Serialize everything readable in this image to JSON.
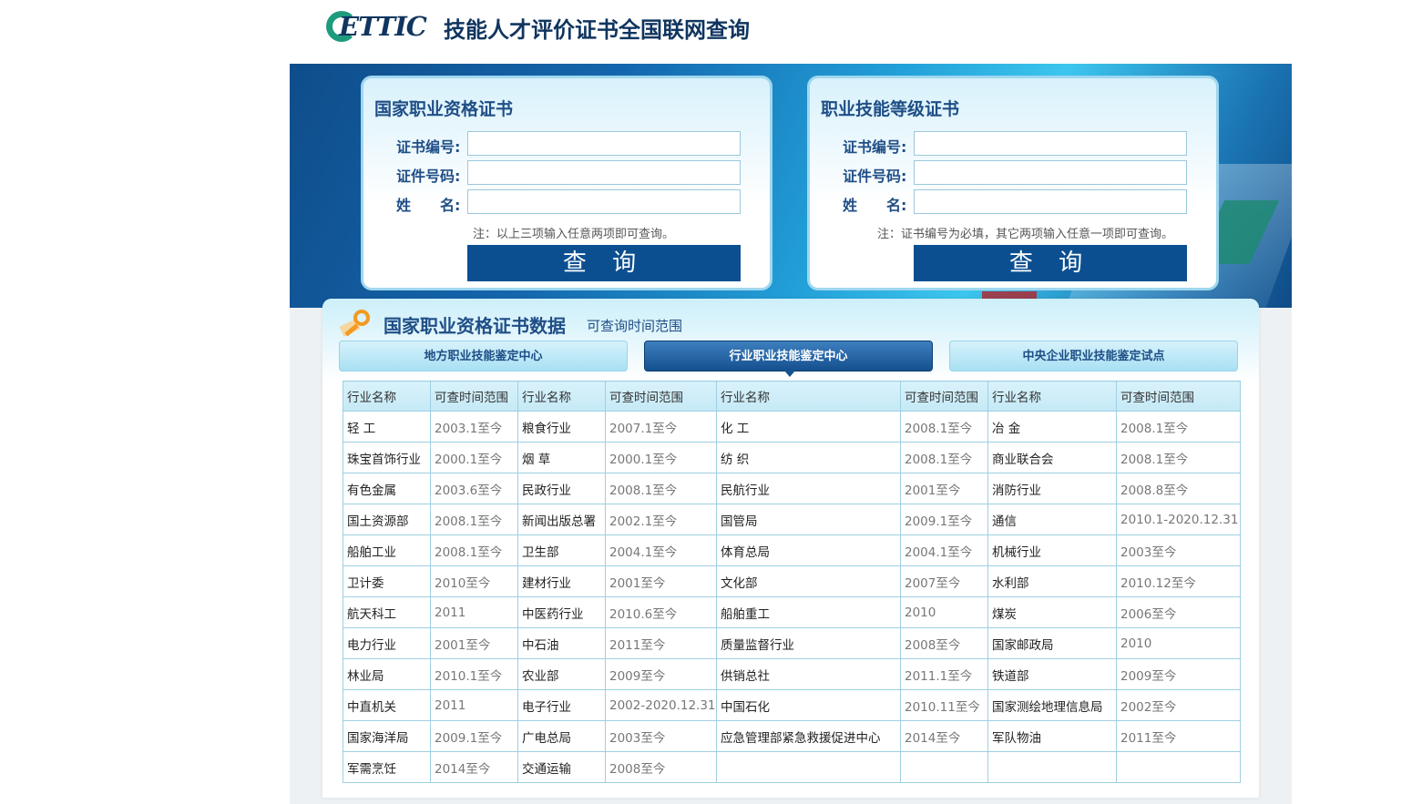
{
  "header": {
    "logo_text": "ETTIC",
    "title": "技能人才评价证书全国联网查询"
  },
  "query_left": {
    "title": "国家职业资格证书",
    "labels": [
      "证书编号:",
      "证件号码:",
      "姓　　名:"
    ],
    "note": "注：以上三项输入任意两项即可查询。",
    "button": "查 询"
  },
  "query_right": {
    "title": "职业技能等级证书",
    "labels": [
      "证书编号:",
      "证件号码:",
      "姓　　名:"
    ],
    "note": "注：证书编号为必填，其它两项输入任意一项即可查询。",
    "button": "查 询"
  },
  "section": {
    "title": "国家职业资格证书数据",
    "subtitle": "可查询时间范围",
    "tabs": [
      {
        "label": "地方职业技能鉴定中心",
        "active": false
      },
      {
        "label": "行业职业技能鉴定中心",
        "active": true
      },
      {
        "label": "中央企业职业技能鉴定试点",
        "active": false
      }
    ]
  },
  "table": {
    "headers": [
      "行业名称",
      "可查时间范围",
      "行业名称",
      "可查时间范围",
      "行业名称",
      "可查时间范围",
      "行业名称",
      "可查时间范围"
    ],
    "rows": [
      [
        "轻 工",
        "2003.1至今",
        "粮食行业",
        "2007.1至今",
        "化 工",
        "2008.1至今",
        "冶 金",
        "2008.1至今"
      ],
      [
        "珠宝首饰行业",
        "2000.1至今",
        "烟 草",
        "2000.1至今",
        "纺 织",
        "2008.1至今",
        "商业联合会",
        "2008.1至今"
      ],
      [
        "有色金属",
        "2003.6至今",
        "民政行业",
        "2008.1至今",
        "民航行业",
        "2001至今",
        "消防行业",
        "2008.8至今"
      ],
      [
        "国土资源部",
        "2008.1至今",
        "新闻出版总署",
        "2002.1至今",
        "国管局",
        "2009.1至今",
        "通信",
        "2010.1-2020.12.31"
      ],
      [
        "船舶工业",
        "2008.1至今",
        "卫生部",
        "2004.1至今",
        "体育总局",
        "2004.1至今",
        "机械行业",
        "2003至今"
      ],
      [
        "卫计委",
        "2010至今",
        "建材行业",
        "2001至今",
        "文化部",
        "2007至今",
        "水利部",
        "2010.12至今"
      ],
      [
        "航天科工",
        "2011",
        "中医药行业",
        "2010.6至今",
        "船舶重工",
        "2010",
        "煤炭",
        "2006至今"
      ],
      [
        "电力行业",
        "2001至今",
        "中石油",
        "2011至今",
        "质量监督行业",
        "2008至今",
        "国家邮政局",
        "2010"
      ],
      [
        "林业局",
        "2010.1至今",
        "农业部",
        "2009至今",
        "供销总社",
        "2011.1至今",
        "铁道部",
        "2009至今"
      ],
      [
        "中直机关",
        "2011",
        "电子行业",
        "2002-2020.12.31",
        "中国石化",
        "2010.11至今",
        "国家测绘地理信息局",
        "2002至今"
      ],
      [
        "国家海洋局",
        "2009.1至今",
        "广电总局",
        "2003至今",
        "应急管理部紧急救援促进中心",
        "2014至今",
        "军队物油",
        "2011至今"
      ],
      [
        "军需烹饪",
        "2014至今",
        "交通运输",
        "2008至今",
        "",
        "",
        "",
        ""
      ]
    ]
  }
}
